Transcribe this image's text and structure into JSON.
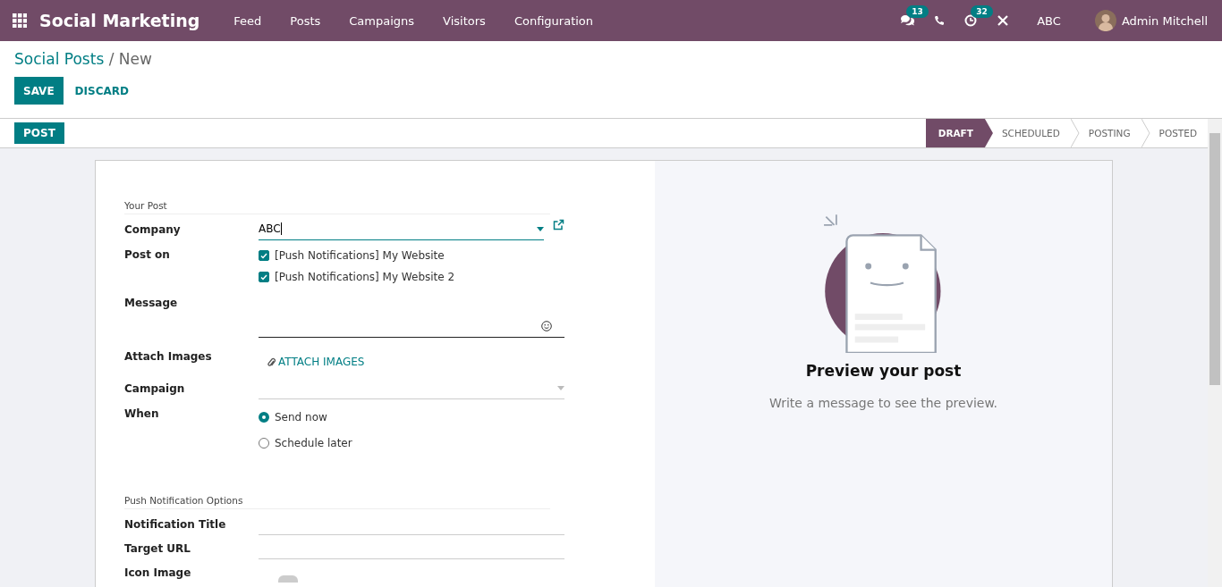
{
  "navbar": {
    "app_name": "Social Marketing",
    "menu": [
      "Feed",
      "Posts",
      "Campaigns",
      "Visitors",
      "Configuration"
    ],
    "systray": [
      {
        "kind": "chat",
        "badge": "13"
      },
      {
        "kind": "phone"
      },
      {
        "kind": "activity",
        "badge": "32"
      },
      {
        "kind": "tools"
      }
    ],
    "company": "ABC",
    "user": "Admin Mitchell"
  },
  "breadcrumb": {
    "parent": "Social Posts",
    "separator": "/",
    "current": "New"
  },
  "buttons": {
    "save": "SAVE",
    "discard": "DISCARD"
  },
  "post_button": "POST",
  "stages": [
    {
      "label": "DRAFT",
      "selected": true
    },
    {
      "label": "SCHEDULED",
      "selected": false
    },
    {
      "label": "POSTING",
      "selected": false
    },
    {
      "label": "POSTED",
      "selected": false
    }
  ],
  "sections": [
    {
      "title": "Your Post",
      "fields": [
        {
          "kind": "select",
          "label": "Company",
          "value": "ABC",
          "focused": true
        },
        {
          "kind": "checkboxes",
          "label": "Post on",
          "options": [
            {
              "label": "[Push Notifications] My Website",
              "checked": true
            },
            {
              "label": "[Push Notifications] My Website 2",
              "checked": true
            }
          ]
        },
        {
          "kind": "textarea",
          "label": "Message"
        },
        {
          "kind": "attach",
          "label": "Attach Images",
          "button": "ATTACH IMAGES"
        },
        {
          "kind": "select",
          "label": "Campaign",
          "focused": false
        },
        {
          "kind": "radio",
          "label": "When",
          "options": [
            {
              "label": "Send now",
              "selected": true
            },
            {
              "label": "Schedule later",
              "selected": false
            }
          ]
        }
      ]
    },
    {
      "title": "Push Notification Options",
      "fields": [
        {
          "kind": "text",
          "label": "Notification Title"
        },
        {
          "kind": "text",
          "label": "Target URL"
        },
        {
          "kind": "image",
          "label": "Icon Image"
        }
      ]
    }
  ],
  "preview": {
    "title": "Preview your post",
    "hint": "Write a message to see the preview."
  }
}
